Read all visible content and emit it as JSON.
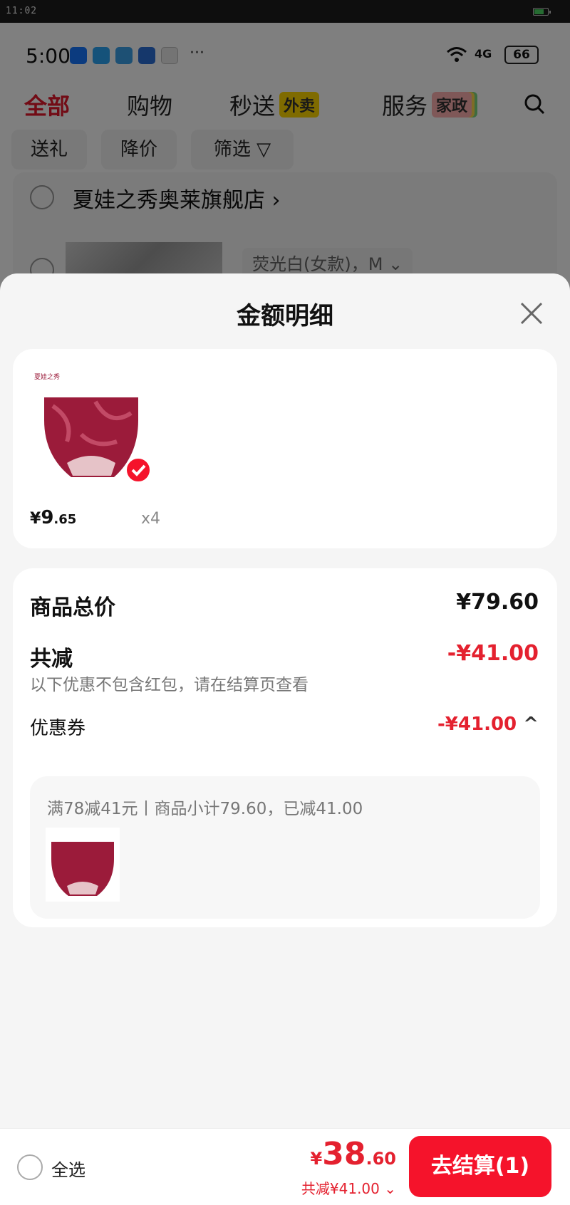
{
  "system_bar": {
    "time": "11:02"
  },
  "background": {
    "status": {
      "time": "5:00",
      "battery": "66",
      "more": "···",
      "network": "4G"
    },
    "tabs": [
      {
        "label": "全部"
      },
      {
        "label": "购物"
      },
      {
        "label": "秒送",
        "tag": "外卖"
      },
      {
        "label": "服务",
        "tag": "家政"
      }
    ],
    "chips": [
      "送礼",
      "降价",
      "筛选"
    ],
    "shop": {
      "name": "夏娃之秀奥莱旗舰店",
      "variant": "荧光白(女款)，M"
    }
  },
  "sheet": {
    "title": "金额明细",
    "product": {
      "price_currency": "¥",
      "price_int": "9",
      "price_dec": ".65",
      "quantity": "x4",
      "brand": "夏娃之秀"
    },
    "summary": {
      "goods_total_label": "商品总价",
      "goods_total_value": "¥79.60",
      "discount_label": "共减",
      "discount_value": "-¥41.00",
      "discount_note": "以下优惠不包含红包，请在结算页查看",
      "coupon_label": "优惠券",
      "coupon_value": "-¥41.00",
      "coupon_detail": "满78减41元丨商品小计79.60，已减41.00"
    }
  },
  "bottom": {
    "select_all": "全选",
    "total_currency": "¥",
    "total_int": "38",
    "total_dec": ".60",
    "total_discount": "共减¥41.00",
    "checkout": "去结算(1)"
  },
  "colors": {
    "accent": "#e4212f",
    "checkout_bg": "#f5132b",
    "product": "#9b1b3a"
  }
}
